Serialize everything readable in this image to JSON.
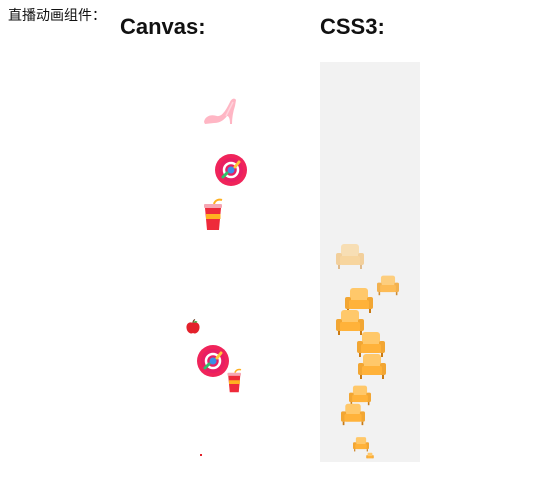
{
  "page": {
    "label": "直播动画组件：",
    "canvas_title": "Canvas:",
    "css3_title": "CSS3:"
  },
  "colors": {
    "css3_stage_bg": "#f2f2f2",
    "text": "#111111",
    "sofa_main": "#ffb23a",
    "sofa_light": "#ffd27a",
    "sofa_dark": "#f0961c",
    "heel_pink": "#ffb0c0",
    "ball_red": "#f0245a",
    "apple_red": "#e3212b",
    "cup_red": "#ee2a3a",
    "cup_yellow": "#ffb020"
  },
  "canvas": {
    "gifts": [
      {
        "icon": "high-heel-icon"
      },
      {
        "icon": "live-badge-icon"
      },
      {
        "icon": "drink-cup-icon"
      },
      {
        "icon": "apple-icon"
      },
      {
        "icon": "live-badge-icon"
      },
      {
        "icon": "drink-cup-icon"
      },
      {
        "icon": "particle-dot-icon"
      }
    ]
  },
  "css3": {
    "gift_icon": "sofa-icon"
  }
}
